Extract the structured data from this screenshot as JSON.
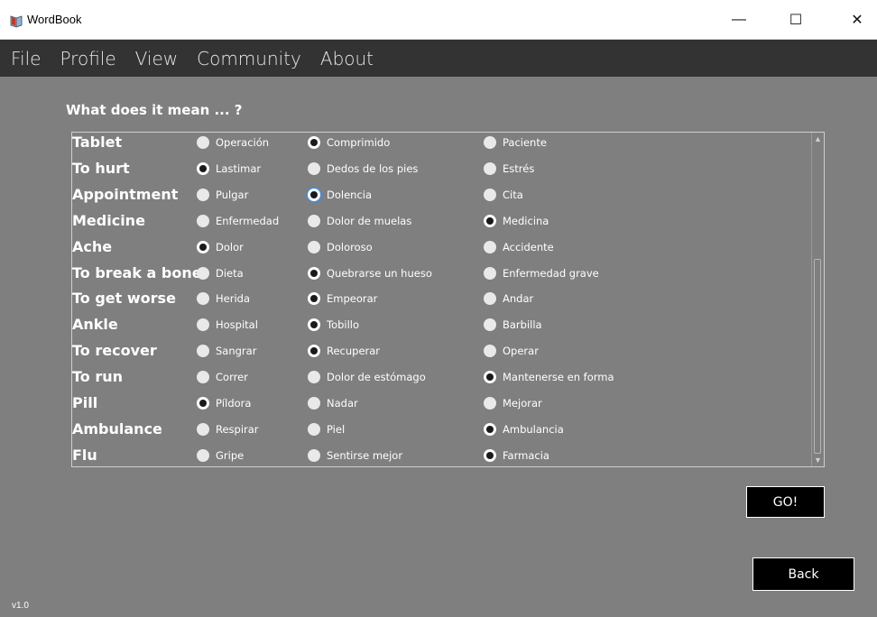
{
  "window": {
    "title": "WordBook",
    "controls": {
      "minimize": "—",
      "maximize": "☐",
      "close": "✕"
    }
  },
  "menu": [
    "File",
    "Profile",
    "View",
    "Community",
    "About"
  ],
  "quiz": {
    "question": "What does it mean ... ?",
    "rows": [
      {
        "word": "Tablet",
        "options": [
          "Operación",
          "Comprimido",
          "Paciente"
        ],
        "selected": 1
      },
      {
        "word": "To hurt",
        "options": [
          "Lastimar",
          "Dedos de los pies",
          "Estrés"
        ],
        "selected": 0
      },
      {
        "word": "Appointment",
        "options": [
          "Pulgar",
          "Dolencia",
          "Cita"
        ],
        "selected": 1,
        "focused": 1
      },
      {
        "word": "Medicine",
        "options": [
          "Enfermedad",
          "Dolor de muelas",
          "Medicina"
        ],
        "selected": 2
      },
      {
        "word": "Ache",
        "options": [
          "Dolor",
          "Doloroso",
          "Accidente"
        ],
        "selected": 0
      },
      {
        "word": "To break a bone",
        "options": [
          "Dieta",
          "Quebrarse un hueso",
          "Enfermedad grave"
        ],
        "selected": 1
      },
      {
        "word": "To get worse",
        "options": [
          "Herida",
          "Empeorar",
          "Andar"
        ],
        "selected": 1
      },
      {
        "word": "Ankle",
        "options": [
          "Hospital",
          "Tobillo",
          "Barbilla"
        ],
        "selected": 1
      },
      {
        "word": "To recover",
        "options": [
          "Sangrar",
          "Recuperar",
          "Operar"
        ],
        "selected": 1
      },
      {
        "word": "To run",
        "options": [
          "Correr",
          "Dolor de estómago",
          "Mantenerse en forma"
        ],
        "selected": 2
      },
      {
        "word": "Pill",
        "options": [
          "Píldora",
          "Nadar",
          "Mejorar"
        ],
        "selected": 0
      },
      {
        "word": "Ambulance",
        "options": [
          "Respirar",
          "Piel",
          "Ambulancia"
        ],
        "selected": 2
      },
      {
        "word": "Flu",
        "options": [
          "Gripe",
          "Sentirse mejor",
          "Farmacia"
        ],
        "selected": 2
      }
    ]
  },
  "buttons": {
    "go": "GO!",
    "back": "Back"
  },
  "version": "v1.0",
  "colors": {
    "background": "#7f7f7f",
    "menubar": "#333333",
    "focus_ring": "#3d8ee6"
  }
}
